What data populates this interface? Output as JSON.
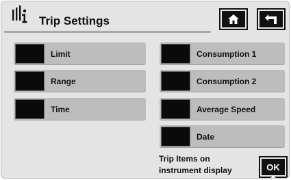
{
  "header": {
    "title": "Trip Settings",
    "app_icon": "info-icon",
    "home_icon": "home-icon",
    "back_icon": "back-arrow-icon"
  },
  "items": [
    {
      "label": "Limit",
      "checked": false
    },
    {
      "label": "Range",
      "checked": false
    },
    {
      "label": "Time",
      "checked": false
    },
    {
      "label": "Consumption 1",
      "checked": false
    },
    {
      "label": "Consumption 2",
      "checked": false
    },
    {
      "label": "Average Speed",
      "checked": false
    },
    {
      "label": "Date",
      "checked": false
    }
  ],
  "footer": {
    "note_line1": "Trip Items on",
    "note_line2": "instrument display",
    "ok_label": "OK"
  }
}
